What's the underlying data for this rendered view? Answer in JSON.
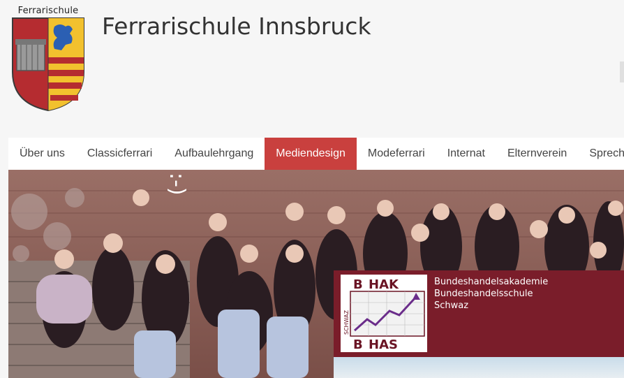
{
  "logo": {
    "text": "Ferrarischule",
    "icon": "coat-of-arms"
  },
  "site_title": "Ferrarischule Innsbruck",
  "nav": {
    "items": [
      {
        "label": "Über uns",
        "active": false
      },
      {
        "label": "Classicferrari",
        "active": false
      },
      {
        "label": "Aufbaulehrgang",
        "active": false
      },
      {
        "label": "Mediendesign",
        "active": true
      },
      {
        "label": "Modeferrari",
        "active": false
      },
      {
        "label": "Internat",
        "active": false
      },
      {
        "label": "Elternverein",
        "active": false
      },
      {
        "label": "Sprechstunden",
        "active": false
      }
    ]
  },
  "hero": {
    "graffiti": ":-)",
    "banner": {
      "logo_top": "HAK",
      "logo_bottom": "HAS",
      "logo_side": "SCHWAZ",
      "lines": [
        "Bundeshandelsakademie",
        "Bundeshandelsschule",
        "Schwaz"
      ]
    }
  },
  "colors": {
    "accent": "#c9403e",
    "banner": "#7a1d2a",
    "title": "#333333"
  }
}
